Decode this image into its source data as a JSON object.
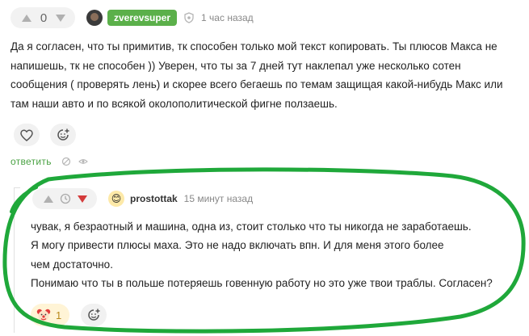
{
  "comment1": {
    "score": "0",
    "username": "zverevsuper",
    "time": "1 час назад",
    "text": "Да я согласен, что ты примитив, тк способен только мой текст копировать. Ты плюсов Макса не напишешь, тк не способен )) Уверен, что ты за 7 дней тут наклепал уже несколько сотен сообщения ( проверять лень) и скорее всего бегаешь по темам защищая какой-нибудь Макс или там наши авто и по всякой околополитической фигне ползаешь.",
    "reply_label": "ответить"
  },
  "comment2": {
    "username": "prostottak",
    "time": "15 минут назад",
    "lines": [
      "чувак, я безраотный и машина, одна из, стоит столько что ты никогда не заработаешь.",
      "Я могу привести плюсы маха. Это не надо включать впн. И для меня этого более",
      "чем достаточно.",
      "Понимаю что ты в польше потеряешь говенную работу но это уже твои траблы. Согласен?"
    ],
    "reaction_count": "1"
  },
  "colors": {
    "accent_green": "#4aa244",
    "badge_green": "#5bb04a",
    "downvote_red": "#d43b3b",
    "outline_green": "#1fa83a"
  },
  "icons": [
    "upvote-icon",
    "downvote-icon",
    "shield-icon",
    "heart-icon",
    "add-reaction-icon",
    "hide-icon",
    "eye-icon",
    "clock-icon",
    "clown-emoji-icon"
  ]
}
